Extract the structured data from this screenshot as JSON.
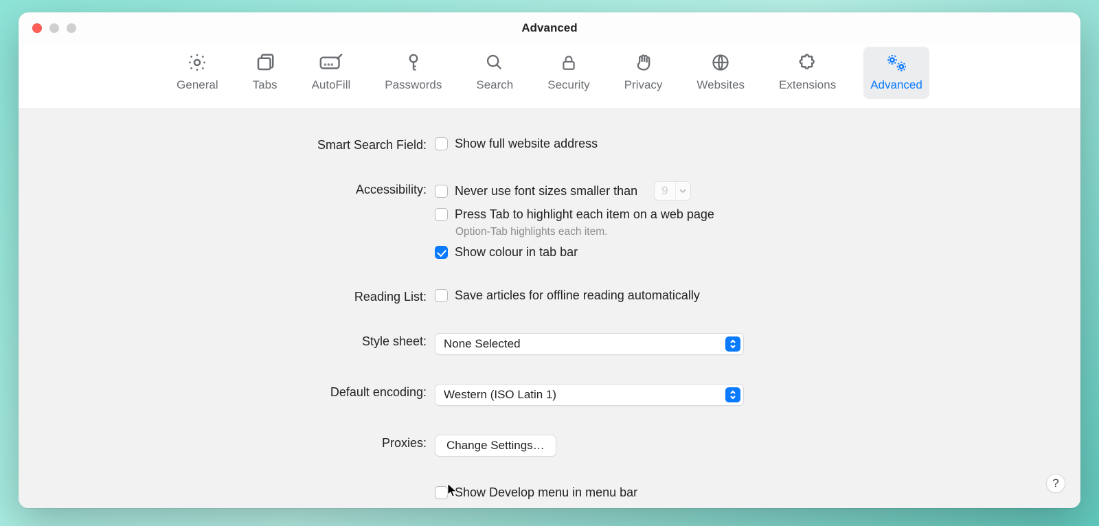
{
  "window": {
    "title": "Advanced"
  },
  "toolbar": {
    "tabs": [
      {
        "label": "General"
      },
      {
        "label": "Tabs"
      },
      {
        "label": "AutoFill"
      },
      {
        "label": "Passwords"
      },
      {
        "label": "Search"
      },
      {
        "label": "Security"
      },
      {
        "label": "Privacy"
      },
      {
        "label": "Websites"
      },
      {
        "label": "Extensions"
      },
      {
        "label": "Advanced"
      }
    ],
    "selected_index": 9
  },
  "sections": {
    "smart_search": {
      "label": "Smart Search Field:",
      "show_full_address": {
        "text": "Show full website address",
        "checked": false
      }
    },
    "accessibility": {
      "label": "Accessibility:",
      "min_font": {
        "text": "Never use font sizes smaller than",
        "checked": false,
        "value": "9"
      },
      "press_tab": {
        "text": "Press Tab to highlight each item on a web page",
        "checked": false
      },
      "hint": "Option-Tab highlights each item.",
      "show_colour": {
        "text": "Show colour in tab bar",
        "checked": true
      }
    },
    "reading_list": {
      "label": "Reading List:",
      "save_offline": {
        "text": "Save articles for offline reading automatically",
        "checked": false
      }
    },
    "style_sheet": {
      "label": "Style sheet:",
      "value": "None Selected"
    },
    "default_encoding": {
      "label": "Default encoding:",
      "value": "Western (ISO Latin 1)"
    },
    "proxies": {
      "label": "Proxies:",
      "button": "Change Settings…"
    },
    "develop": {
      "text": "Show Develop menu in menu bar",
      "checked": false
    }
  },
  "help_tooltip": "?"
}
